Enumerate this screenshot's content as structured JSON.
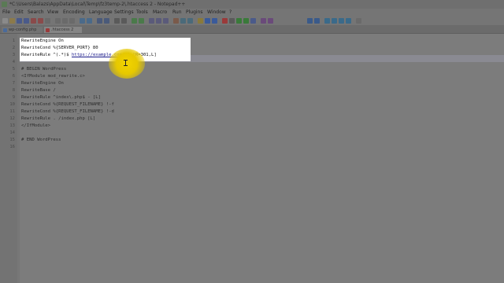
{
  "window": {
    "title": "*C:\\Users\\Balazs\\AppData\\Local\\Temp\\fz3temp-2\\.htaccess 2 - Notepad++"
  },
  "menu": [
    "File",
    "Edit",
    "Search",
    "View",
    "Encoding",
    "Language",
    "Settings",
    "Tools",
    "Macro",
    "Run",
    "Plugins",
    "Window",
    "?"
  ],
  "toolbar": {
    "icons": [
      "new-file-icon",
      "open-icon",
      "save-icon",
      "save-all-icon",
      "close-icon",
      "close-all-icon",
      "print-icon",
      "cut-icon",
      "copy-icon",
      "paste-icon",
      "undo-icon",
      "redo-icon",
      "find-icon",
      "replace-icon",
      "zoom-in-icon",
      "zoom-out-icon",
      "sync-v-icon",
      "sync-h-icon",
      "word-wrap-icon",
      "all-chars-icon",
      "indent-guide-icon",
      "lang-icon",
      "doc-map-icon",
      "func-list-icon",
      "folder-icon",
      "monitor-icon",
      "record-icon",
      "stop-icon",
      "play-icon",
      "play-multi-icon",
      "save-macro-icon",
      "spell-icon",
      "spell2-icon",
      "compare-icon",
      "compare2-icon",
      "prev-icon",
      "next-icon",
      "first-icon",
      "last-icon",
      "clear-icon"
    ]
  },
  "tabs": [
    {
      "label": "wp-config.php"
    },
    {
      "label": ".htaccess 2"
    }
  ],
  "editor": {
    "lines": [
      {
        "n": "1",
        "text": "RewriteEngine On"
      },
      {
        "n": "2",
        "text": "RewriteCond %{SERVER_PORT} 80"
      },
      {
        "n": "3",
        "text_before": "RewriteRule ^(.*)$ ",
        "url": "https://example.com",
        "text_after": "/$1 [R=301,L]"
      },
      {
        "n": "4",
        "text": ""
      },
      {
        "n": "5",
        "text": "# BEGIN WordPress"
      },
      {
        "n": "6",
        "text": "<IfModule mod_rewrite.c>"
      },
      {
        "n": "7",
        "text": "RewriteEngine On"
      },
      {
        "n": "8",
        "text": "RewriteBase /"
      },
      {
        "n": "9",
        "text": "RewriteRule ^index\\.php$ - [L]"
      },
      {
        "n": "10",
        "text": "RewriteCond %{REQUEST_FILENAME} !-f"
      },
      {
        "n": "11",
        "text": "RewriteCond %{REQUEST_FILENAME} !-d"
      },
      {
        "n": "12",
        "text": "RewriteRule . /index.php [L]"
      },
      {
        "n": "13",
        "text": "</IfModule>"
      },
      {
        "n": "14",
        "text": ""
      },
      {
        "n": "15",
        "text": "# END WordPress"
      },
      {
        "n": "16",
        "text": ""
      }
    ]
  },
  "colors": {
    "highlight": "#ffffff",
    "cursor_halo": "#f2d400",
    "dim_overlay": "#7a7a7a"
  }
}
